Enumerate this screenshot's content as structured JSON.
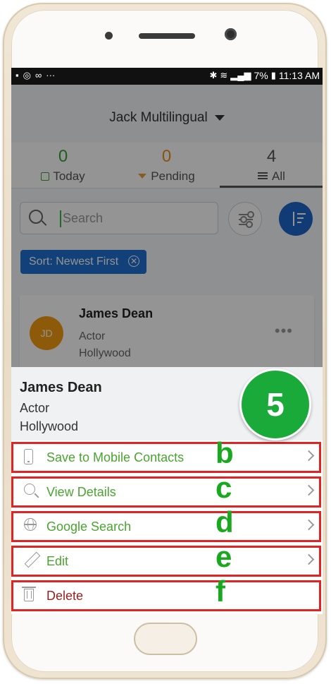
{
  "status_bar": {
    "battery": "7%",
    "time": "11:13 AM"
  },
  "header": {
    "title": "Jack Multilingual"
  },
  "tabs": [
    {
      "count": "0",
      "label": "Today",
      "color": "#3aa234"
    },
    {
      "count": "0",
      "label": "Pending",
      "color": "#e8901d"
    },
    {
      "count": "4",
      "label": "All",
      "color": "#555555"
    }
  ],
  "search": {
    "placeholder": "Search"
  },
  "sort_chip": {
    "label": "Sort: Newest First"
  },
  "contact_card": {
    "initials": "JD",
    "name": "James Dean",
    "line2": "Actor",
    "line3": "Hollywood",
    "avatar_color": "#f39c12"
  },
  "sheet": {
    "name": "James Dean",
    "line2": "Actor",
    "line3": "Hollywood",
    "step_badge": "5",
    "options": [
      {
        "label": "Save to Mobile Contacts",
        "marker": "b",
        "icon": "phone-icon"
      },
      {
        "label": "View Details",
        "marker": "c",
        "icon": "zoom-icon"
      },
      {
        "label": "Google Search",
        "marker": "d",
        "icon": "globe-icon"
      },
      {
        "label": "Edit",
        "marker": "e",
        "icon": "pencil-icon"
      },
      {
        "label": "Delete",
        "marker": "f",
        "icon": "trash-icon"
      }
    ]
  },
  "colors": {
    "accent_green": "#49a52f",
    "annotation_red": "#e02424",
    "badge_green": "#1aaa3a",
    "sort_blue": "#1e66c9",
    "delete_red": "#9b1c1c"
  }
}
